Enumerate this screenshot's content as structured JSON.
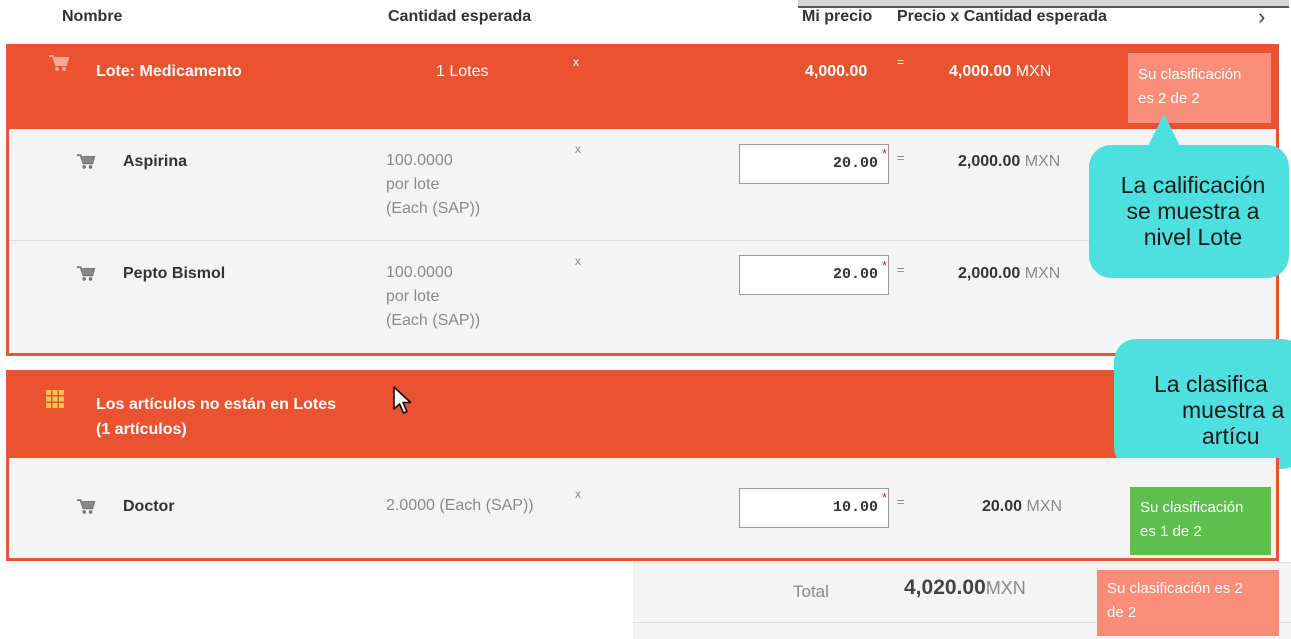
{
  "columns": {
    "name": "Nombre",
    "expected_qty": "Cantidad esperada",
    "my_price": "Mi precio",
    "price_x_qty": "Precio x Cantidad esperada",
    "next": "›"
  },
  "lot": {
    "title": "Lote: Medicamento",
    "qty": "1 Lotes",
    "x": "x",
    "price": "4,000.00",
    "eq": "=",
    "total": "4,000.00",
    "currency": "MXN",
    "ranking_line1": "Su clasificación",
    "ranking_line2": "es 2 de 2",
    "items": [
      {
        "name": "Aspirina",
        "qty_line1": "100.0000",
        "qty_line2": "por lote",
        "qty_line3": "(Each (SAP))",
        "x": "x",
        "price": "20.00",
        "star": "*",
        "eq": "=",
        "total": "2,000.00",
        "currency": "MXN"
      },
      {
        "name": "Pepto Bismol",
        "qty_line1": "100.0000",
        "qty_line2": "por lote",
        "qty_line3": "(Each (SAP))",
        "x": "x",
        "price": "20.00",
        "star": "*",
        "eq": "=",
        "total": "2,000.00",
        "currency": "MXN"
      }
    ]
  },
  "callouts": {
    "lot_level": [
      "La calificación",
      "se muestra a",
      "nivel Lote"
    ],
    "item_level": [
      "La clasifica",
      "muestra a",
      "artícu"
    ]
  },
  "nolot": {
    "title_line1": "Los artículos no están en Lotes",
    "title_line2": "(1 artículos)",
    "items": [
      {
        "name": "Doctor",
        "qty": "2.0000 (Each (SAP))",
        "x": "x",
        "price": "10.00",
        "star": "*",
        "eq": "=",
        "total": "20.00",
        "currency": "MXN",
        "ranking_line1": "Su clasificación",
        "ranking_line2": "es 1 de 2"
      }
    ]
  },
  "footer": {
    "total_label": "Total",
    "total_value": "4,020.00",
    "currency": "MXN",
    "ranking_line1": "Su clasificación es 2",
    "ranking_line2": "de 2"
  },
  "colors": {
    "band": "#e9532f",
    "ranking_red": "#fc8d79",
    "ranking_green": "#5cc04a",
    "callout": "#4ee0de"
  },
  "icons": [
    "cart-icon",
    "grid-icon",
    "mouse-cursor-icon",
    "chevron-right-icon"
  ]
}
